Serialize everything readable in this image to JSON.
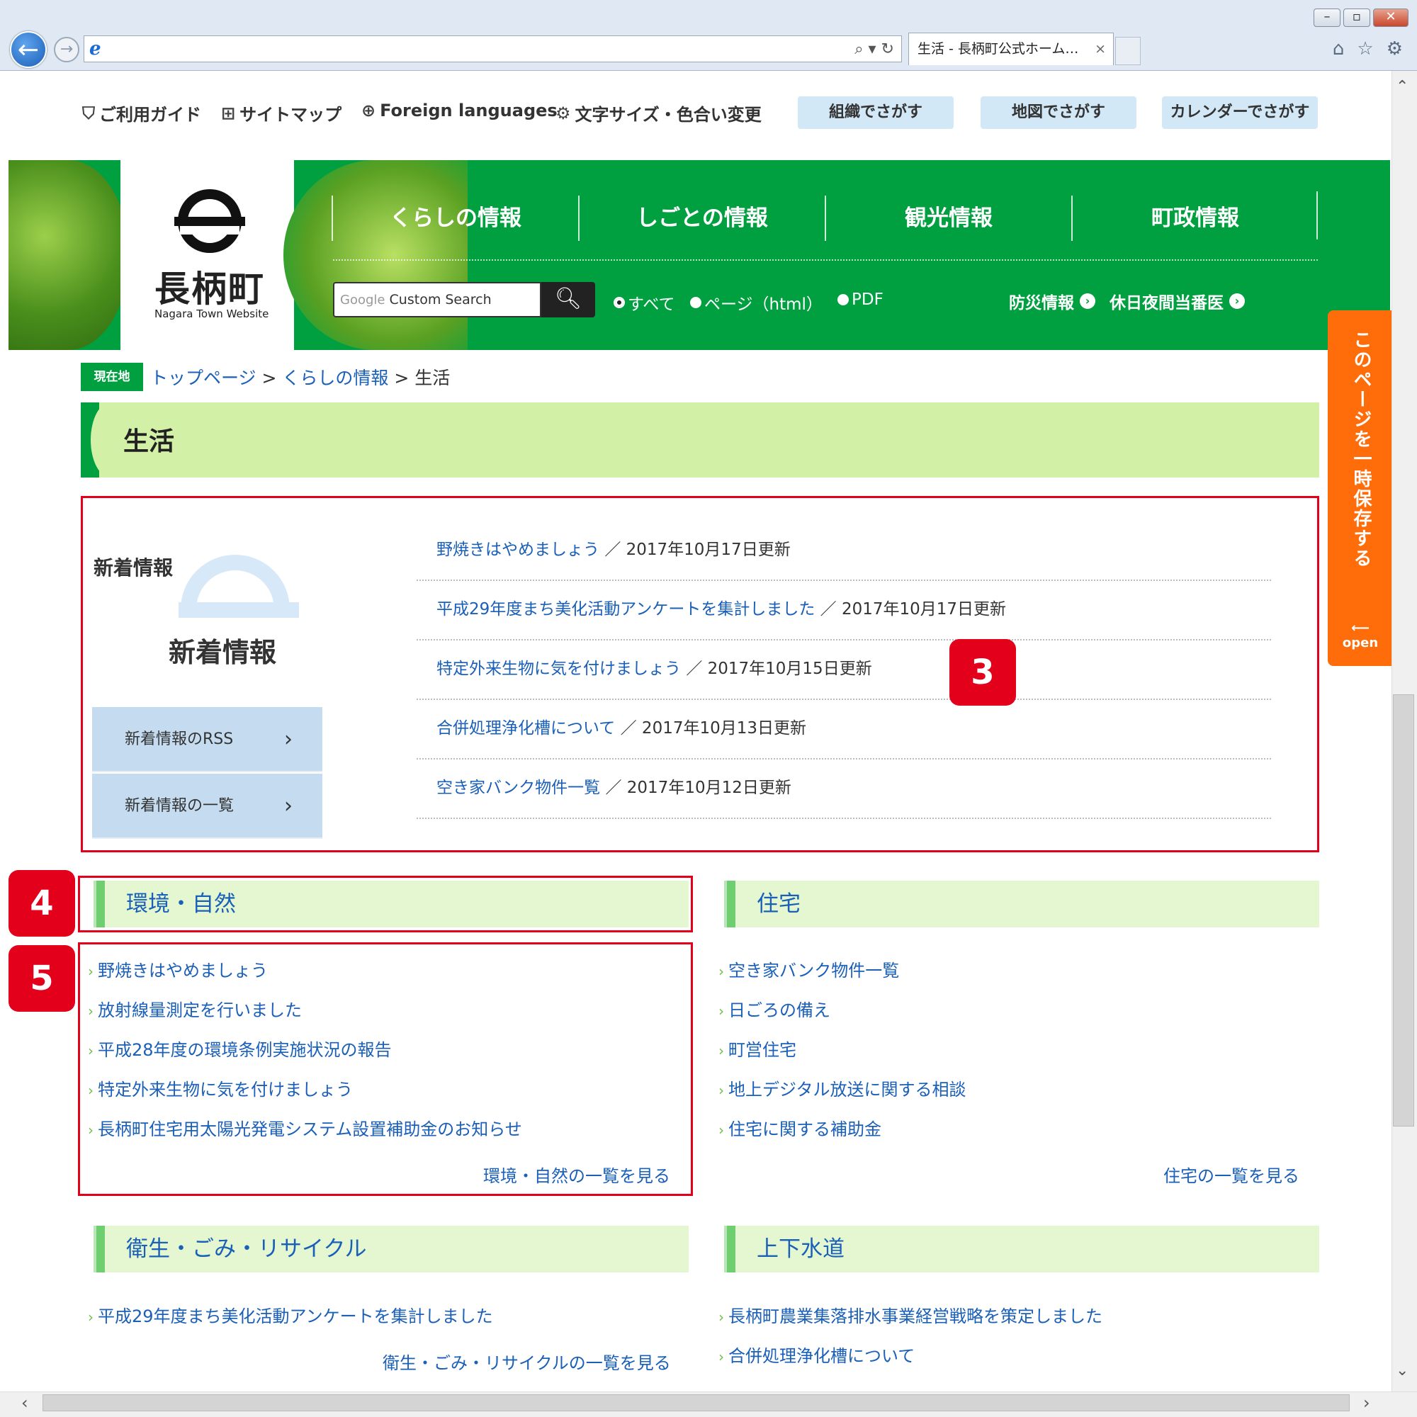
{
  "browser": {
    "tab_title": "生活 - 長柄町公式ホーム…",
    "tab_close": "×",
    "address_controls": "⌕ ▾ ↻",
    "win_min": "▭",
    "win_max": "▭",
    "win_close": "✕"
  },
  "utility": {
    "guide": "ご利用ガイド",
    "sitemap": "サイトマップ",
    "foreign": "Foreign languages",
    "font": "文字サイズ・色合い変更",
    "search_org": "組織でさがす",
    "search_map": "地図でさがす",
    "search_cal": "カレンダーでさがす"
  },
  "header": {
    "logo_text": "長柄町",
    "logo_sub": "Nagara Town Website",
    "nav": [
      "くらしの情報",
      "しごとの情報",
      "観光情報",
      "町政情報"
    ],
    "search_google": "Google",
    "search_placeholder": "Custom Search",
    "radio_all": "すべて",
    "radio_page": "ページ（html）",
    "radio_pdf": "PDF",
    "link_disaster": "防災情報",
    "link_holiday": "休日夜間当番医"
  },
  "breadcrumb": {
    "tag": "現在地",
    "top": "トップページ",
    "sep": ">",
    "kurashi": "くらしの情報",
    "current": "生活"
  },
  "page_title": "生活",
  "news": {
    "heading": "新着情報",
    "big_label": "新着情報",
    "rss_button": "新着情報のRSS",
    "list_button": "新着情報の一覧",
    "items": [
      {
        "title": "野焼きはやめましょう",
        "date": "／ 2017年10月17日更新"
      },
      {
        "title": "平成29年度まち美化活動アンケートを集計しました",
        "date": "／ 2017年10月17日更新"
      },
      {
        "title": "特定外来生物に気を付けましょう",
        "date": "／ 2017年10月15日更新"
      },
      {
        "title": "合併処理浄化槽について",
        "date": "／ 2017年10月13日更新"
      },
      {
        "title": "空き家バンク物件一覧",
        "date": "／ 2017年10月12日更新"
      }
    ]
  },
  "badges": {
    "b3": "3",
    "b4": "4",
    "b5": "5"
  },
  "categories": {
    "env": {
      "title": "環境・自然",
      "items": [
        "野焼きはやめましょう",
        "放射線量測定を行いました",
        "平成28年度の環境条例実施状況の報告",
        "特定外来生物に気を付けましょう",
        "長柄町住宅用太陽光発電システム設置補助金のお知らせ"
      ],
      "more": "環境・自然の一覧を見る"
    },
    "housing": {
      "title": "住宅",
      "items": [
        "空き家バンク物件一覧",
        "日ごろの備え",
        "町営住宅",
        "地上デジタル放送に関する相談",
        "住宅に関する補助金"
      ],
      "more": "住宅の一覧を見る"
    },
    "hygiene": {
      "title": "衛生・ごみ・リサイクル",
      "items": [
        "平成29年度まち美化活動アンケートを集計しました"
      ],
      "more": "衛生・ごみ・リサイクルの一覧を見る"
    },
    "water": {
      "title": "上下水道",
      "items": [
        "長柄町農業集落排水事業経営戦略を策定しました",
        "合併処理浄化槽について"
      ]
    }
  },
  "side_tab": {
    "label": "このページを一時保存する",
    "open": "open"
  },
  "colors": {
    "brand_green": "#00a040",
    "title_bg": "#d2f0a6",
    "link_blue": "#1a5fb8",
    "highlight_red": "#e3001a",
    "side_tab_orange": "#ff6d0a"
  }
}
